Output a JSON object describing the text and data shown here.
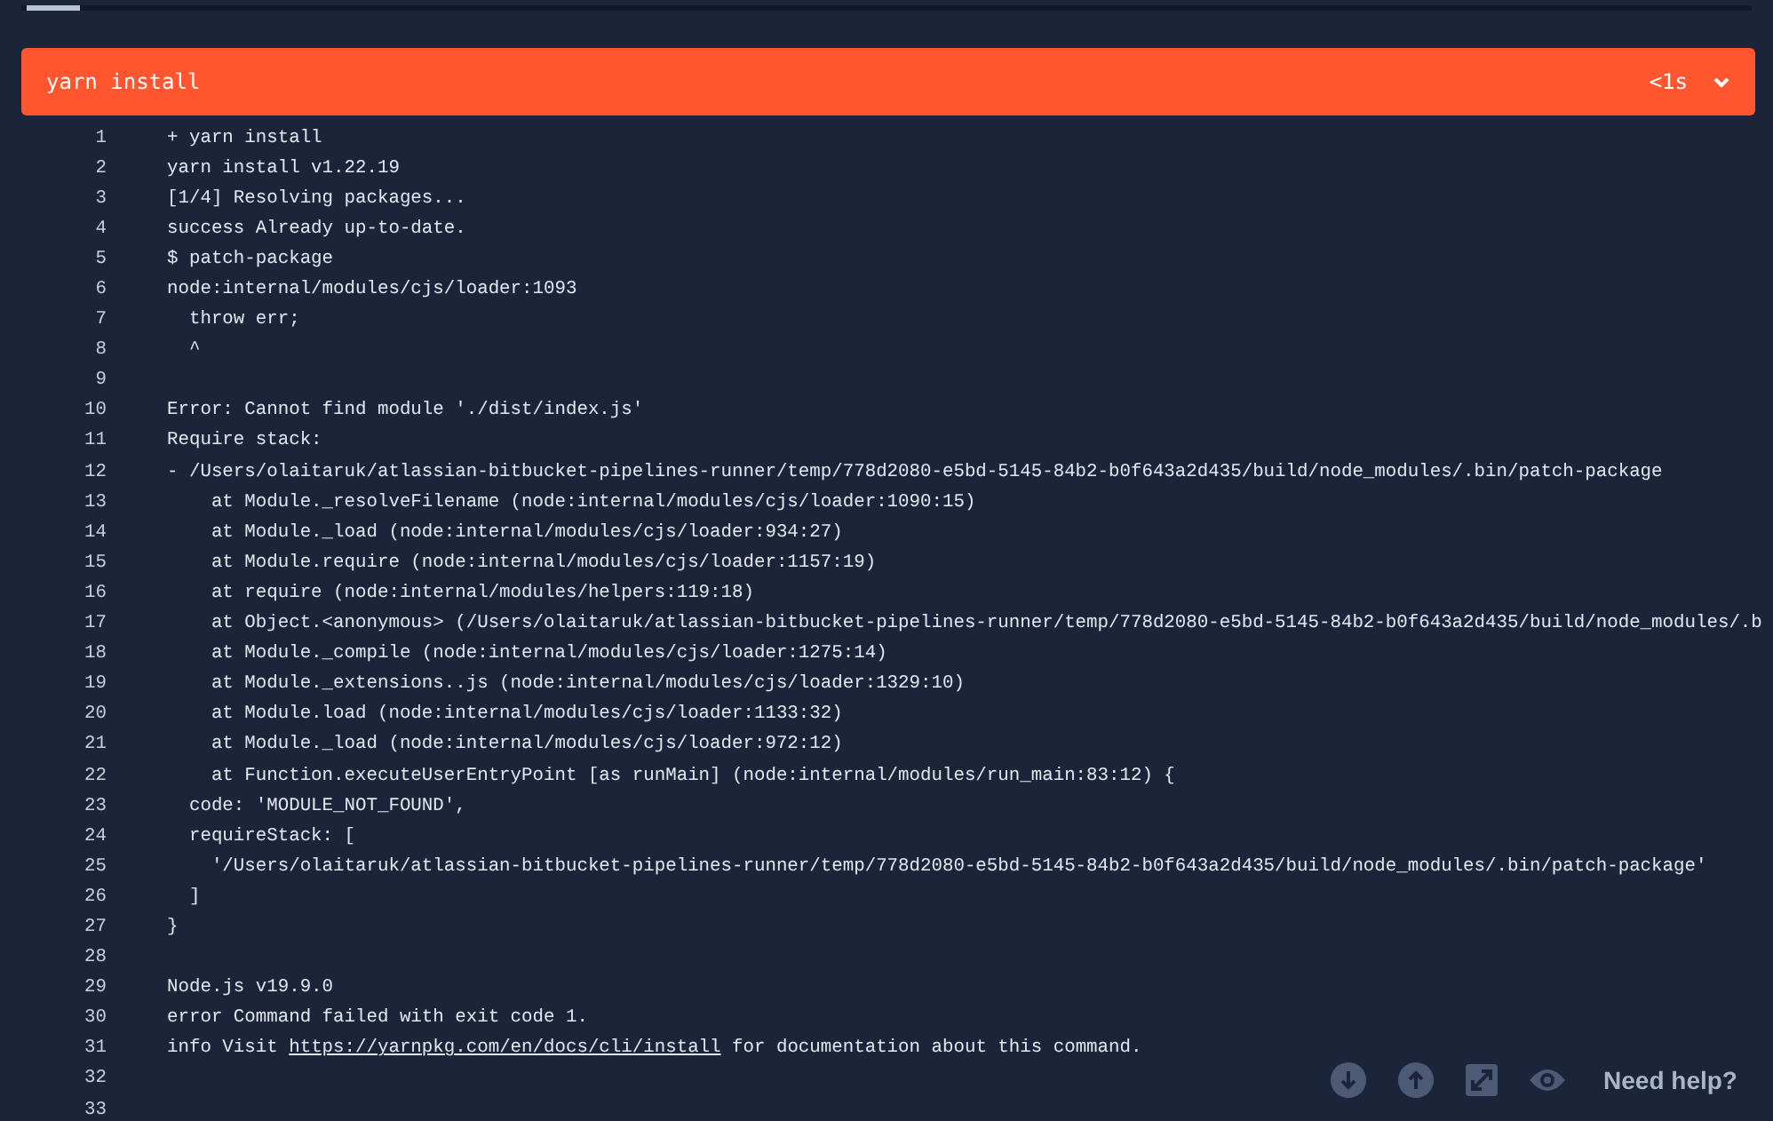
{
  "step": {
    "title": "yarn install",
    "duration": "<1s",
    "expanded": true
  },
  "log": [
    {
      "number": "1",
      "text": "+ yarn install"
    },
    {
      "number": "2",
      "text": "yarn install v1.22.19"
    },
    {
      "number": "3",
      "text": "[1/4] Resolving packages..."
    },
    {
      "number": "4",
      "text": "success Already up-to-date."
    },
    {
      "number": "5",
      "text": "$ patch-package"
    },
    {
      "number": "6",
      "text": "node:internal/modules/cjs/loader:1093"
    },
    {
      "number": "7",
      "text": "  throw err;"
    },
    {
      "number": "8",
      "text": "  ^"
    },
    {
      "number": "9"
    },
    {
      "number": "10",
      "text": "Error: Cannot find module './dist/index.js'"
    },
    {
      "number": "11",
      "text": "Require stack:"
    },
    {
      "number": "12",
      "text": "- /Users/olaitaruk/atlassian-bitbucket-pipelines-runner/temp/778d2080-e5bd-5145-84b2-b0f643a2d435/build/node_modules/.bin/patch-package"
    },
    {
      "number": "13",
      "text": "    at Module._resolveFilename (node:internal/modules/cjs/loader:1090:15)"
    },
    {
      "number": "14",
      "text": "    at Module._load (node:internal/modules/cjs/loader:934:27)"
    },
    {
      "number": "15",
      "text": "    at Module.require (node:internal/modules/cjs/loader:1157:19)"
    },
    {
      "number": "16",
      "text": "    at require (node:internal/modules/helpers:119:18)"
    },
    {
      "number": "17",
      "text": "    at Object.<anonymous> (/Users/olaitaruk/atlassian-bitbucket-pipelines-runner/temp/778d2080-e5bd-5145-84b2-b0f643a2d435/build/node_modules/.b"
    },
    {
      "number": "18",
      "text": "    at Module._compile (node:internal/modules/cjs/loader:1275:14)"
    },
    {
      "number": "19",
      "text": "    at Module._extensions..js (node:internal/modules/cjs/loader:1329:10)"
    },
    {
      "number": "20",
      "text": "    at Module.load (node:internal/modules/cjs/loader:1133:32)"
    },
    {
      "number": "21",
      "text": "    at Module._load (node:internal/modules/cjs/loader:972:12)"
    },
    {
      "number": "22",
      "text": "    at Function.executeUserEntryPoint [as runMain] (node:internal/modules/run_main:83:12) {"
    },
    {
      "number": "23",
      "text": "  code: 'MODULE_NOT_FOUND',"
    },
    {
      "number": "24",
      "text": "  requireStack: ["
    },
    {
      "number": "25",
      "text": "    '/Users/olaitaruk/atlassian-bitbucket-pipelines-runner/temp/778d2080-e5bd-5145-84b2-b0f643a2d435/build/node_modules/.bin/patch-package'"
    },
    {
      "number": "26",
      "text": "  ]"
    },
    {
      "number": "27",
      "text": "}"
    },
    {
      "number": "28"
    },
    {
      "number": "29",
      "text": "Node.js v19.9.0"
    },
    {
      "number": "30",
      "text": "error Command failed with exit code 1."
    },
    {
      "number": "31",
      "text": "info Visit ",
      "link": "https://yarnpkg.com/en/docs/cli/install",
      "text_after": " for documentation about this command."
    },
    {
      "number": "32"
    },
    {
      "number": "33"
    }
  ],
  "help": "Need help?"
}
